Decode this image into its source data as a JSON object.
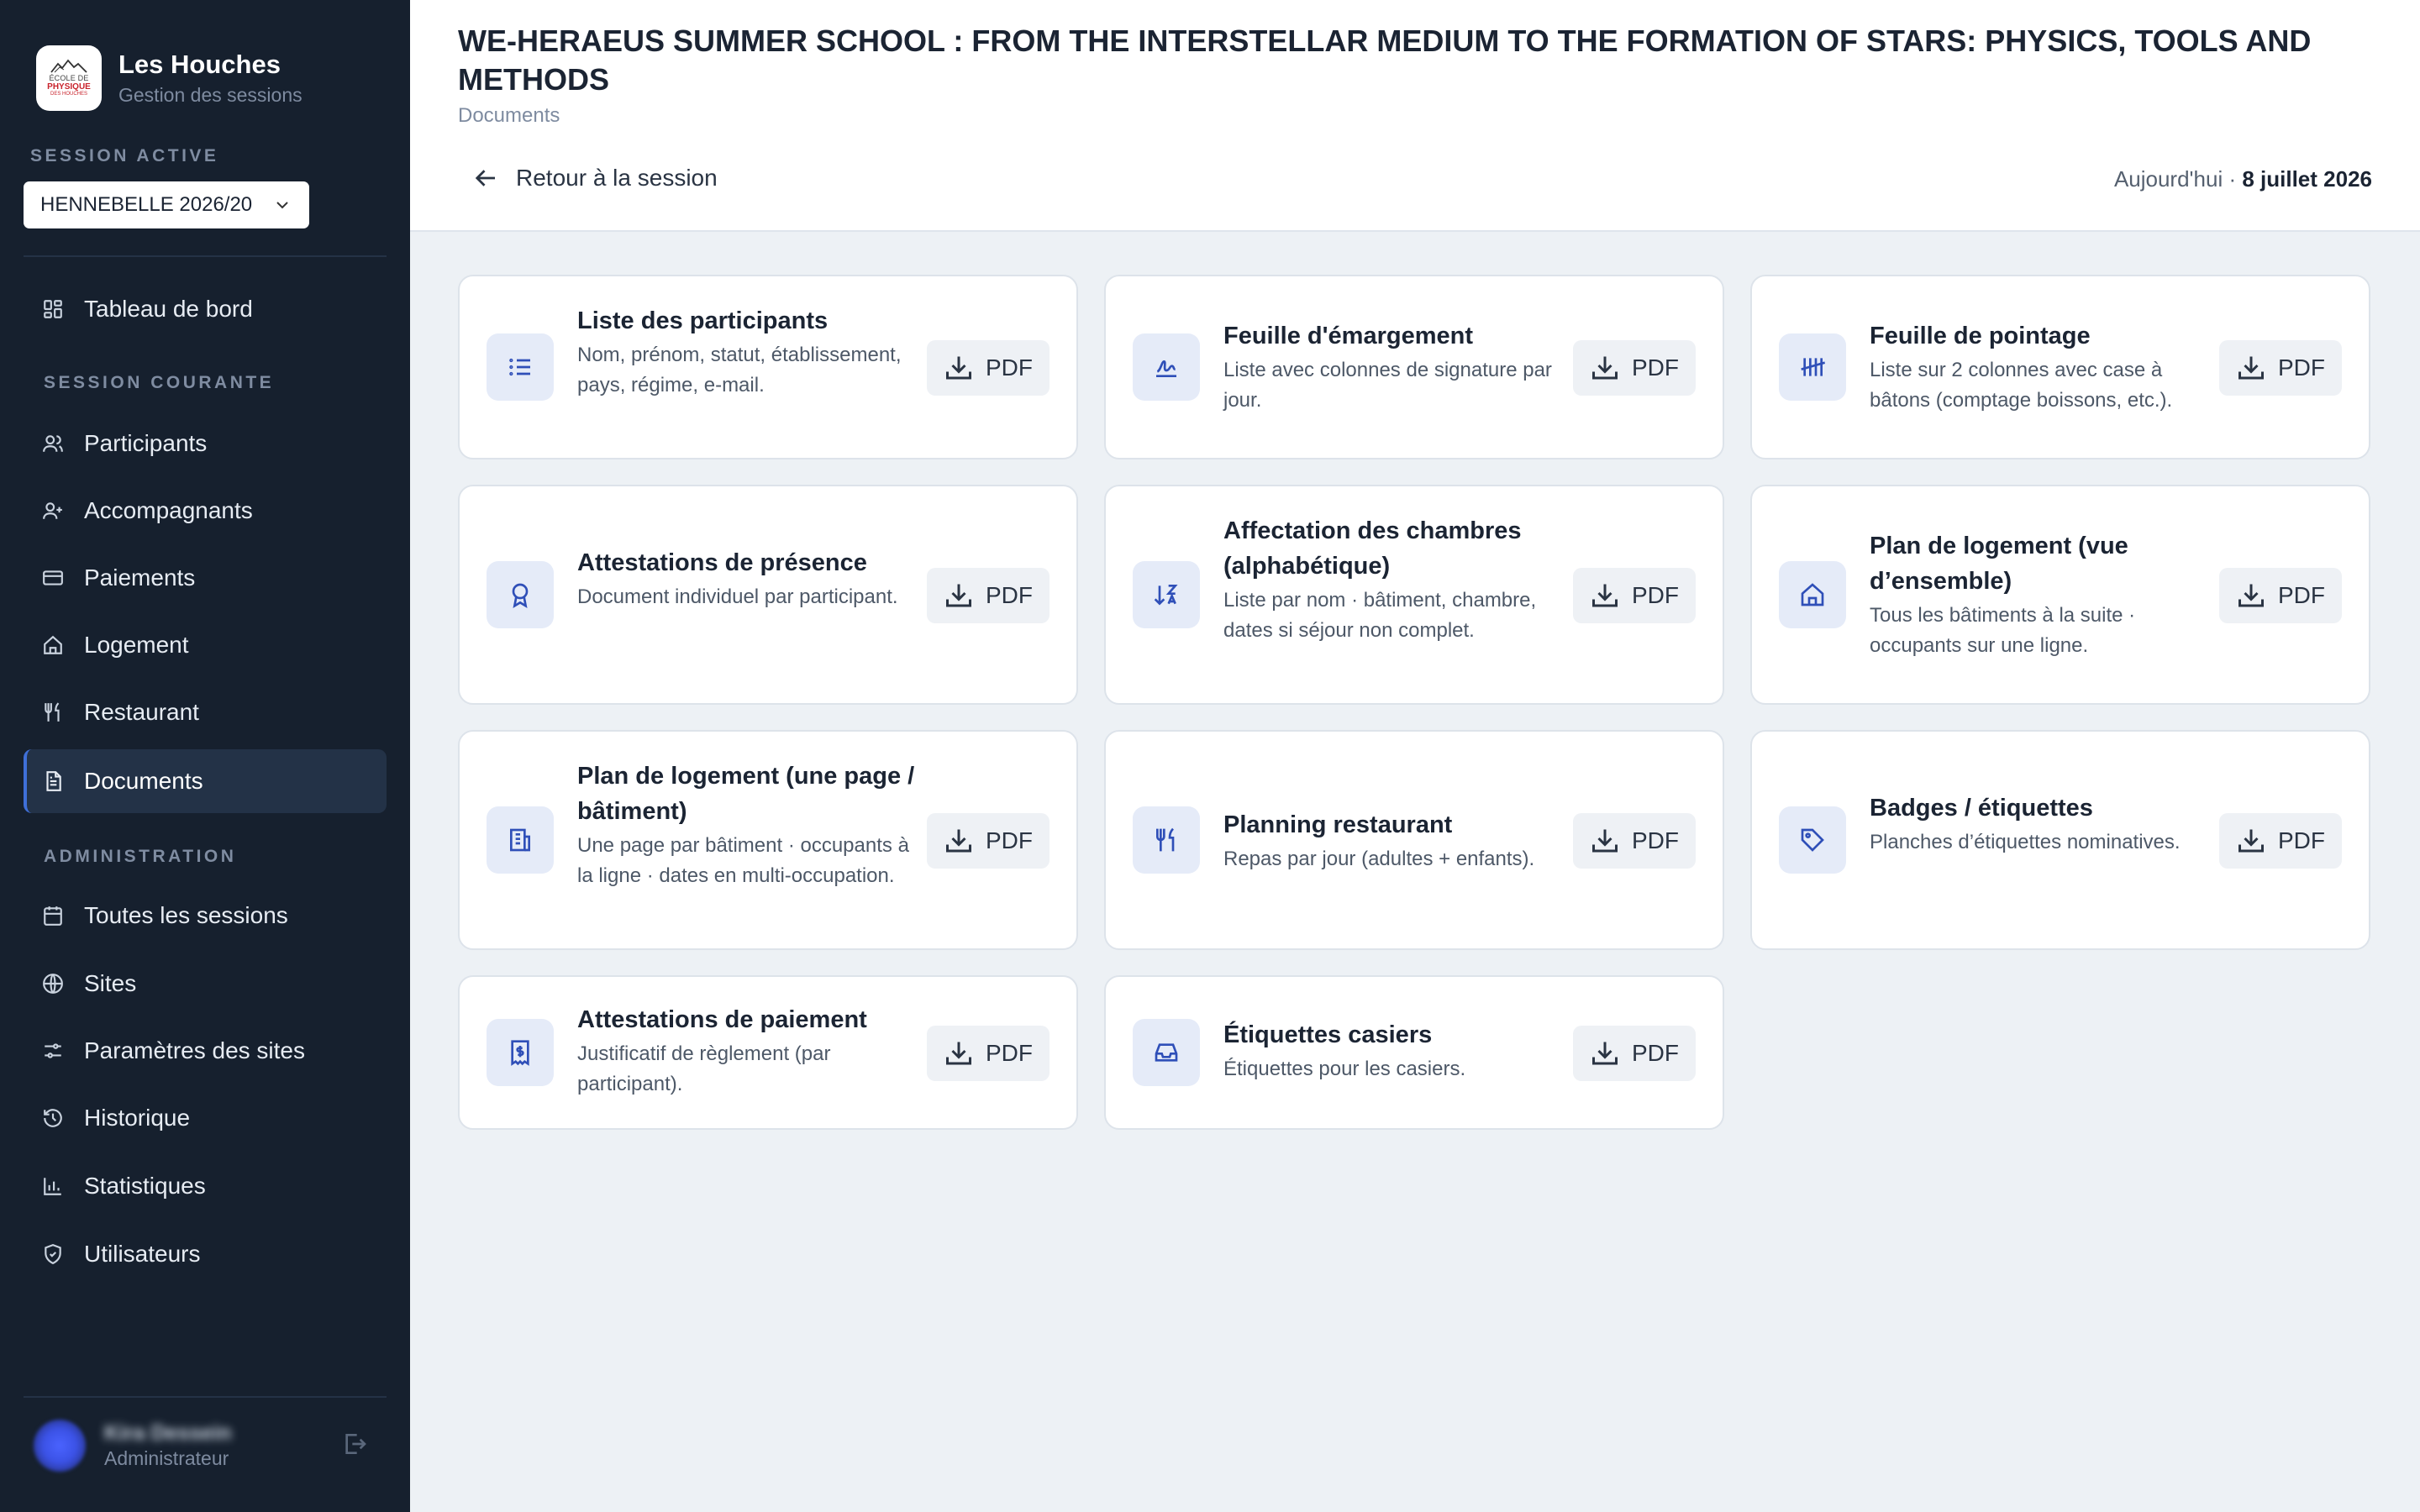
{
  "brand": {
    "logo_lines": [
      "ÉCOLE DE",
      "PHYSIQUE",
      "DES HOUCHES"
    ],
    "title": "Les Houches",
    "subtitle": "Gestion des sessions"
  },
  "session": {
    "label": "SESSION ACTIVE",
    "selected": "HENNEBELLE 2026/20"
  },
  "nav": {
    "dashboard": "Tableau de bord",
    "current_section": "SESSION COURANTE",
    "current_items": [
      "Participants",
      "Accompagnants",
      "Paiements",
      "Logement",
      "Restaurant",
      "Documents"
    ],
    "admin_section": "ADMINISTRATION",
    "admin_items": [
      "Toutes les sessions",
      "Sites",
      "Paramètres des sites",
      "Historique",
      "Statistiques",
      "Utilisateurs"
    ],
    "active": "Documents"
  },
  "user": {
    "name": "Kira Dessein",
    "role": "Administrateur"
  },
  "header": {
    "title": "WE-HERAEUS SUMMER SCHOOL : FROM THE INTERSTELLAR MEDIUM TO THE FORMATION OF STARS: PHYSICS, TOOLS AND METHODS",
    "subtitle": "Documents",
    "back_label": "Retour à la session",
    "today_label": "Aujourd'hui ·",
    "today_date": "8 juillet 2026"
  },
  "documents": [
    {
      "title": "Liste des participants",
      "description": "Nom, prénom, statut, établissement, pays, régime, e-mail.",
      "button": "PDF",
      "icon": "list-icon"
    },
    {
      "title": "Feuille d'émargement",
      "description": "Liste avec colonnes de signature par jour.",
      "button": "PDF",
      "icon": "signature-icon"
    },
    {
      "title": "Feuille de pointage",
      "description": "Liste sur 2 colonnes avec case à bâtons (comptage boissons, etc.).",
      "button": "PDF",
      "icon": "tally-icon"
    },
    {
      "title": "Attestations de présence",
      "description": "Document individuel par participant.",
      "button": "PDF",
      "icon": "award-icon"
    },
    {
      "title": "Affectation des chambres (alphabétique)",
      "description": "Liste par nom · bâtiment, chambre, dates si séjour non complet.",
      "button": "PDF",
      "icon": "sort-az-icon"
    },
    {
      "title": "Plan de logement (vue d’ensemble)",
      "description": "Tous les bâtiments à la suite · occupants sur une ligne.",
      "button": "PDF",
      "icon": "house-icon"
    },
    {
      "title": "Plan de logement (une page / bâtiment)",
      "description": "Une page par bâtiment · occupants à la ligne · dates en multi-occupation.",
      "button": "PDF",
      "icon": "building-icon"
    },
    {
      "title": "Planning restaurant",
      "description": "Repas par jour (adultes + enfants).",
      "button": "PDF",
      "icon": "utensils-icon"
    },
    {
      "title": "Badges / étiquettes",
      "description": "Planches d’étiquettes nominatives.",
      "button": "PDF",
      "icon": "tag-icon"
    },
    {
      "title": "Attestations de paiement",
      "description": "Justificatif de règlement (par participant).",
      "button": "PDF",
      "icon": "receipt-icon"
    },
    {
      "title": "Étiquettes casiers",
      "description": "Étiquettes pour les casiers.",
      "button": "PDF",
      "icon": "inbox-icon"
    }
  ],
  "colors": {
    "sidebar_bg": "#16202e",
    "active_nav_bg": "#233247",
    "accent": "#3f6fd8",
    "icon_tint": "#2f4fb8",
    "page_bg": "#edf1f5"
  }
}
